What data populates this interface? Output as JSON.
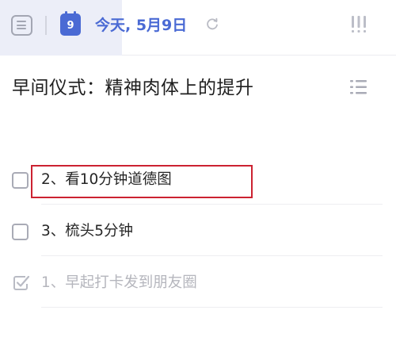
{
  "toolbar": {
    "calendar_day": "9",
    "date_label": "今天, 5月9日"
  },
  "task": {
    "title": "早间仪式：精神肉体上的提升"
  },
  "subtasks": [
    {
      "label": "2、看10分钟道德图",
      "done": false
    },
    {
      "label": "3、梳头5分钟",
      "done": false
    },
    {
      "label": "1、早起打卡发到朋友圈",
      "done": true
    }
  ],
  "colors": {
    "accent": "#4a6ad4",
    "highlight_frame": "#cc2231",
    "done_text": "#b5b6bd"
  }
}
